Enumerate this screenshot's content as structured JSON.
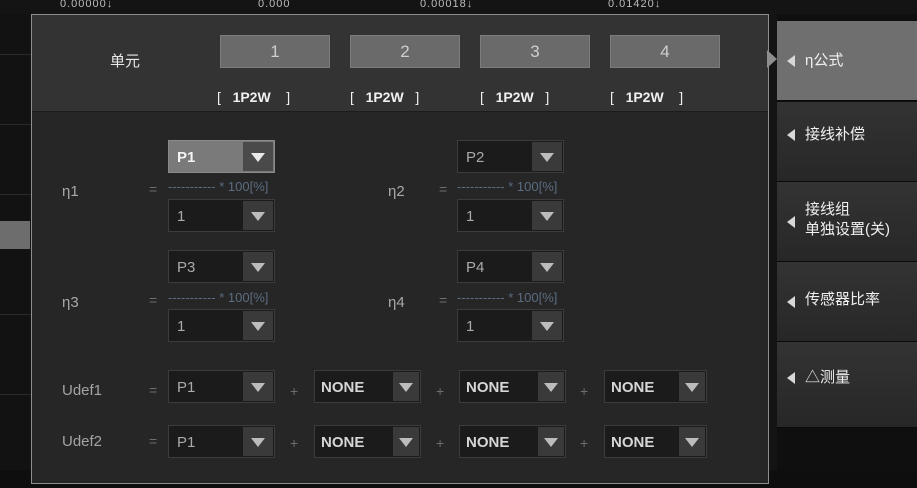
{
  "background": {
    "top_values": [
      "0.00000↓",
      "0.000",
      "0.00018↓",
      "0.01420↓"
    ]
  },
  "dialog": {
    "unit_label": "单元",
    "units": [
      "1",
      "2",
      "3",
      "4"
    ],
    "wirings": [
      {
        "open": "[",
        "value": "1P2W",
        "close": "]"
      },
      {
        "open": "[",
        "value": "1P2W",
        "close": "]"
      },
      {
        "open": "[",
        "value": "1P2W",
        "close": "]"
      },
      {
        "open": "[",
        "value": "1P2W",
        "close": "]"
      }
    ],
    "formulas": [
      {
        "label": "η1",
        "eq": "=",
        "fraction": "----------- * 100[%]",
        "numerator": "P1",
        "denominator": "1",
        "active": true
      },
      {
        "label": "η2",
        "eq": "=",
        "fraction": "----------- * 100[%]",
        "numerator": "P2",
        "denominator": "1",
        "active": false
      },
      {
        "label": "η3",
        "eq": "=",
        "fraction": "----------- * 100[%]",
        "numerator": "P3",
        "denominator": "1",
        "active": false
      },
      {
        "label": "η4",
        "eq": "=",
        "fraction": "----------- * 100[%]",
        "numerator": "P4",
        "denominator": "1",
        "active": false
      }
    ],
    "udefs": [
      {
        "label": "Udef1",
        "eq": "=",
        "terms": [
          "P1",
          "NONE",
          "NONE",
          "NONE"
        ],
        "plus": "+"
      },
      {
        "label": "Udef2",
        "eq": "=",
        "terms": [
          "P1",
          "NONE",
          "NONE",
          "NONE"
        ],
        "plus": "+"
      }
    ]
  },
  "menu": {
    "items": [
      {
        "label": "η公式",
        "active": true
      },
      {
        "label": "接线补偿",
        "active": false
      },
      {
        "label": "接线组\n单独设置(关)",
        "active": false
      },
      {
        "label": "传感器比率",
        "active": false
      },
      {
        "label": "△测量",
        "active": false
      }
    ]
  },
  "colors": {
    "dialog_bg": "#262626",
    "header_bg": "#333333",
    "active_menu": "#6f6f6f",
    "fraction_text": "#5b6c80"
  }
}
